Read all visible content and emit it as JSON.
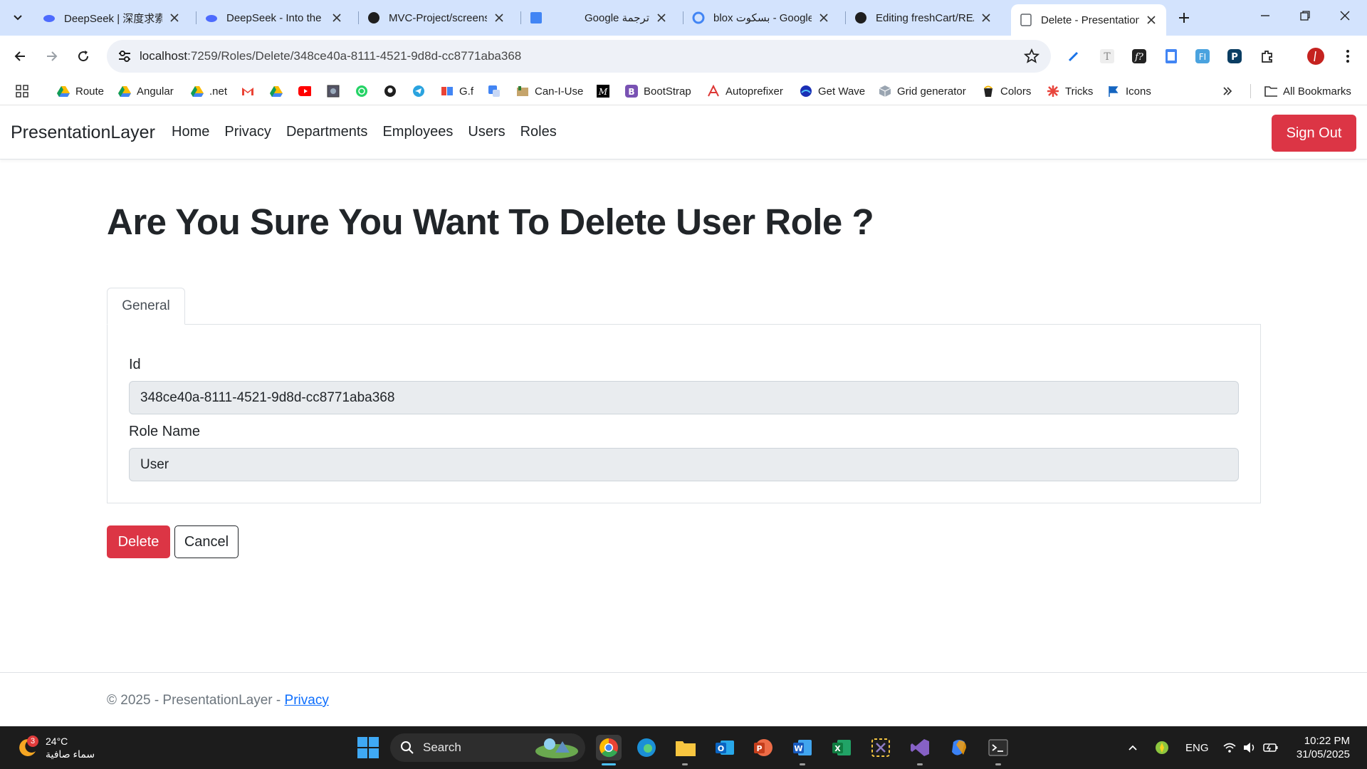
{
  "browser": {
    "tabs": [
      {
        "title": "DeepSeek | 深度求索",
        "icon": "deepseek-whale-icon"
      },
      {
        "title": "DeepSeek - Into the Unknown",
        "icon": "deepseek-whale-icon"
      },
      {
        "title": "MVC-Project/screenshots",
        "icon": "github-icon"
      },
      {
        "title": "Google ترجمة",
        "icon": "google-translate-icon"
      },
      {
        "title": "blox بسكوت - Google",
        "icon": "google-icon"
      },
      {
        "title": "Editing freshCart/README",
        "icon": "github-icon"
      },
      {
        "title": "Delete - PresentationLayer",
        "icon": "page-icon",
        "active": true
      }
    ],
    "url_host": "localhost",
    "url_path": ":7259/Roles/Delete/348ce40a-8111-4521-9d8d-cc8771aba368",
    "bookmarks": [
      {
        "label": "Route",
        "icon": "drive-icon"
      },
      {
        "label": "Angular",
        "icon": "drive-icon"
      },
      {
        "label": ".net",
        "icon": "drive-icon"
      },
      {
        "label": "",
        "icon": "gmail-icon"
      },
      {
        "label": "",
        "icon": "drive-icon"
      },
      {
        "label": "",
        "icon": "youtube-icon"
      },
      {
        "label": "",
        "icon": "image-icon"
      },
      {
        "label": "",
        "icon": "whatsapp-icon"
      },
      {
        "label": "",
        "icon": "github-icon"
      },
      {
        "label": "",
        "icon": "telegram-icon"
      },
      {
        "label": "G.f",
        "icon": "gf-icon"
      },
      {
        "label": "",
        "icon": "translate-icon"
      },
      {
        "label": "Can-I-Use",
        "icon": "caniuse-icon"
      },
      {
        "label": "",
        "icon": "medium-icon"
      },
      {
        "label": "BootStrap",
        "icon": "bootstrap-icon"
      },
      {
        "label": "Autoprefixer",
        "icon": "autoprefixer-icon"
      },
      {
        "label": "Get Wave",
        "icon": "wave-icon"
      },
      {
        "label": "Grid generator",
        "icon": "grid-icon"
      },
      {
        "label": "Colors",
        "icon": "colors-icon"
      },
      {
        "label": "Tricks",
        "icon": "tricks-icon"
      },
      {
        "label": "Icons",
        "icon": "flag-icon"
      }
    ],
    "all_bookmarks": "All Bookmarks"
  },
  "app": {
    "brand": "PresentationLayer",
    "nav": [
      "Home",
      "Privacy",
      "Departments",
      "Employees",
      "Users",
      "Roles"
    ],
    "sign_out": "Sign Out"
  },
  "page": {
    "heading": "Are You Sure You Want To Delete User Role ?",
    "tab": "General",
    "fields": [
      {
        "label": "Id",
        "value": "348ce40a-8111-4521-9d8d-cc8771aba368"
      },
      {
        "label": "Role Name",
        "value": "User"
      }
    ],
    "delete_label": "Delete",
    "cancel_label": "Cancel"
  },
  "footer": {
    "text": "© 2025 - PresentationLayer - ",
    "link": "Privacy"
  },
  "taskbar": {
    "weather_temp": "24°C",
    "weather_desc": "سماء صافية",
    "weather_badge": "3",
    "search": "Search",
    "lang": "ENG",
    "time": "10:22 PM",
    "date": "31/05/2025"
  },
  "colors": {
    "danger": "#dc3545",
    "link": "#0d6efd",
    "tabbar": "#d3e3fd"
  }
}
